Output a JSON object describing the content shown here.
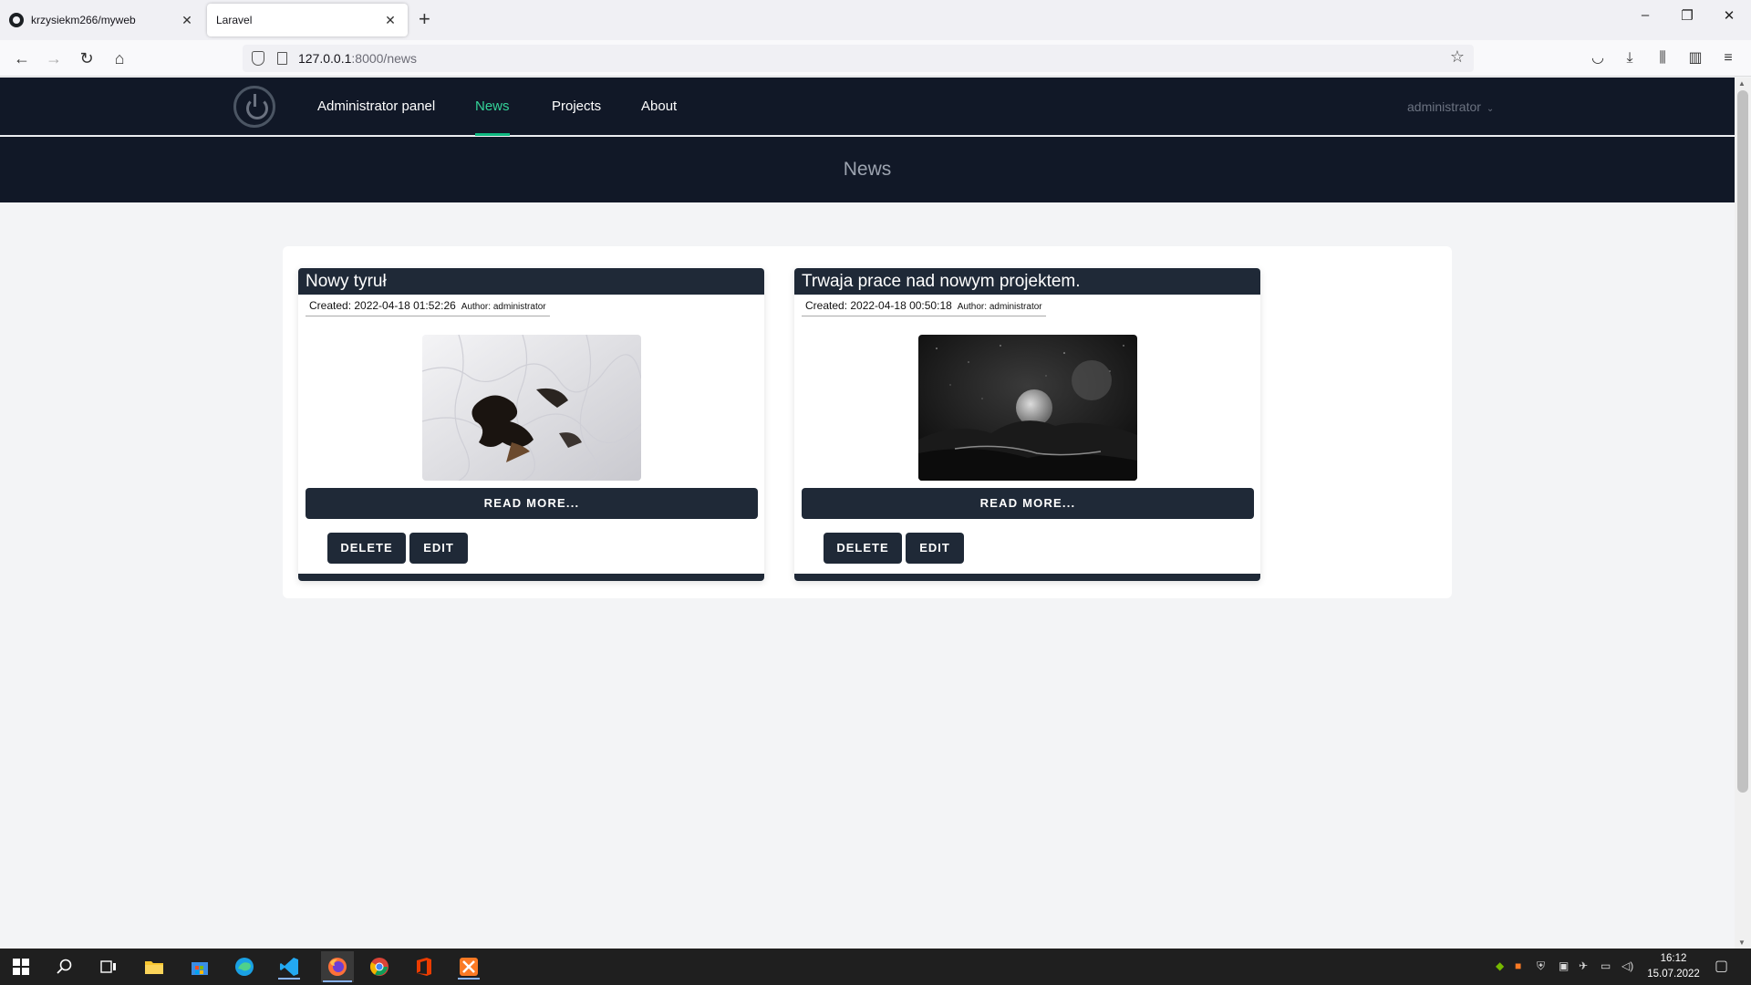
{
  "browser": {
    "tabs": [
      {
        "title": "krzysiekm266/myweb",
        "close": "✕"
      },
      {
        "title": "Laravel",
        "close": "✕"
      }
    ],
    "new_tab": "+",
    "url_host": "127.0.0.1",
    "url_path": ":8000/news",
    "window_controls": {
      "minimize": "–",
      "restore": "❐",
      "close": "✕"
    }
  },
  "site_nav": {
    "links": [
      "Administrator panel",
      "News",
      "Projects",
      "About"
    ],
    "active_link": "News",
    "user": "administrator",
    "user_chevron": "⌄"
  },
  "page_header": {
    "title": "News"
  },
  "news": [
    {
      "title": "Nowy tyruł",
      "created": "Created: 2022-04-18 01:52:26",
      "author": "Author: administrator",
      "image_icon": "puzzle-image",
      "read_more": "READ MORE...",
      "delete": "DELETE",
      "edit": "EDIT"
    },
    {
      "title": "Trwaja prace nad nowym projektem.",
      "created": "Created: 2022-04-18 00:50:18",
      "author": "Author: administrator",
      "image_icon": "moon-landscape-image",
      "read_more": "READ MORE...",
      "delete": "DELETE",
      "edit": "EDIT"
    }
  ],
  "taskbar": {
    "time": "16:12",
    "date": "15.07.2022"
  },
  "colors": {
    "nav_bg": "#111827",
    "accent": "#10b981",
    "card_dark": "#1f2937",
    "page_bg": "#f3f4f6"
  }
}
